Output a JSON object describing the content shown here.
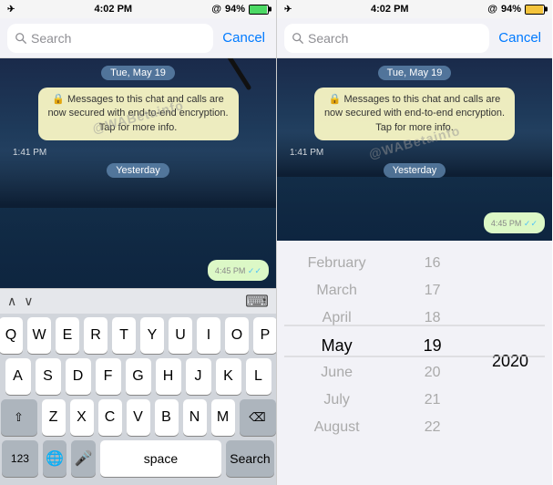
{
  "left_panel": {
    "status": {
      "time": "4:02 PM",
      "battery": "94%",
      "battery_value": 94
    },
    "search": {
      "placeholder": "Search",
      "cancel_label": "Cancel"
    },
    "chat": {
      "date_pill": "Tue, May 19",
      "system_message": "Messages to this chat and calls are now secured with end-to-end encryption. Tap for more info.",
      "lock_icon": "🔒",
      "time_1": "1:41 PM",
      "yesterday_pill": "Yesterday",
      "sent_time": "4:45 PM",
      "checkmarks": "✓✓"
    },
    "arrow_bar": {
      "up": "∧",
      "down": "∨"
    },
    "keyboard": {
      "row1": [
        "Q",
        "W",
        "E",
        "R",
        "T",
        "Y",
        "U",
        "I",
        "O",
        "P"
      ],
      "row2": [
        "A",
        "S",
        "D",
        "F",
        "G",
        "H",
        "J",
        "K",
        "L"
      ],
      "row3": [
        "Z",
        "X",
        "C",
        "V",
        "B",
        "N",
        "M"
      ],
      "shift": "⇧",
      "delete": "⌫",
      "num": "123",
      "globe": "🌐",
      "mic": "🎤",
      "space": "space",
      "search": "Search"
    },
    "watermark": "@WABetainfo"
  },
  "right_panel": {
    "status": {
      "time": "4:02 PM",
      "battery": "94%",
      "battery_value": 94
    },
    "search": {
      "placeholder": "Search",
      "cancel_label": "Cancel"
    },
    "chat": {
      "date_pill": "Tue, May 19",
      "system_message": "Messages to this chat and calls are now secured with end-to-end encryption. Tap for more info.",
      "lock_icon": "🔒",
      "time_1": "1:41 PM",
      "yesterday_pill": "Yesterday",
      "sent_time": "4:45 PM",
      "checkmarks": "✓✓"
    },
    "date_picker": {
      "months": [
        "February",
        "March",
        "April",
        "May",
        "June",
        "July",
        "August"
      ],
      "days": [
        16,
        17,
        18,
        19,
        20,
        21,
        22
      ],
      "years": [
        2020
      ],
      "selected_month": "May",
      "selected_day": 19,
      "selected_year": 2020
    },
    "watermark": "@WABetainfo"
  }
}
